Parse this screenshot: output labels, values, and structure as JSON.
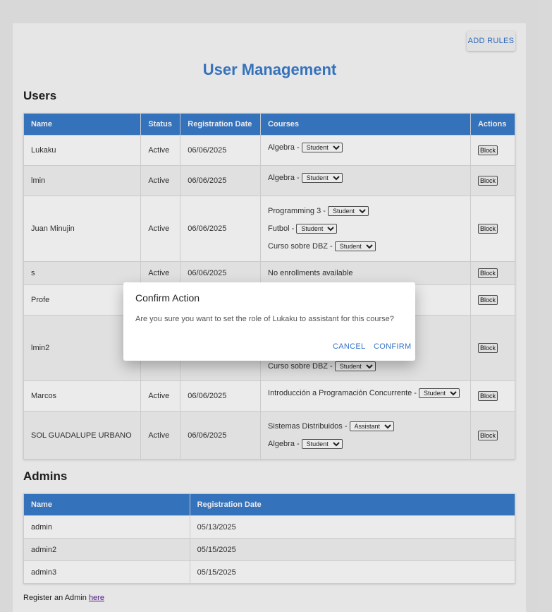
{
  "toolbar": {
    "add_rules": "ADD RULES"
  },
  "page_title": "User Management",
  "users": {
    "title": "Users",
    "headers": [
      "Name",
      "Status",
      "Registration Date",
      "Courses",
      "Actions"
    ],
    "block_label": "Block",
    "rows": [
      {
        "name": "Lukaku",
        "status": "Active",
        "date": "06/06/2025",
        "courses": [
          {
            "name": "Algebra -",
            "role": "Student"
          }
        ]
      },
      {
        "name": "lmin",
        "status": "Active",
        "date": "06/06/2025",
        "courses": [
          {
            "name": "Algebra -",
            "role": "Student"
          }
        ]
      },
      {
        "name": "Juan Minujin",
        "status": "Active",
        "date": "06/06/2025",
        "courses": [
          {
            "name": "Programming 3 -",
            "role": "Student"
          },
          {
            "name": "Futbol -",
            "role": "Student"
          },
          {
            "name": "Curso sobre DBZ -",
            "role": "Student"
          }
        ]
      },
      {
        "name": "s",
        "status": "Active",
        "date": "06/06/2025",
        "courses_text": "No enrollments available"
      },
      {
        "name": "Profe",
        "status": "",
        "date": "",
        "courses": []
      },
      {
        "name": "lmin2",
        "status": "",
        "date": "",
        "courses": [
          {
            "name": "Curso sobre DBZ -",
            "role": "Student"
          }
        ]
      },
      {
        "name": "Marcos",
        "status": "Active",
        "date": "06/06/2025",
        "courses": [
          {
            "name": "Introducción a Programación Concurrente -",
            "role": "Student"
          }
        ]
      },
      {
        "name": "SOL GUADALUPE URBANO",
        "status": "Active",
        "date": "06/06/2025",
        "courses": [
          {
            "name": "Sistemas Distribuidos -",
            "role": "Assistant"
          },
          {
            "name": "Algebra -",
            "role": "Student"
          }
        ]
      }
    ]
  },
  "admins": {
    "title": "Admins",
    "headers": [
      "Name",
      "Registration Date"
    ],
    "rows": [
      {
        "name": "admin",
        "date": "05/13/2025"
      },
      {
        "name": "admin2",
        "date": "05/15/2025"
      },
      {
        "name": "admin3",
        "date": "05/15/2025"
      }
    ]
  },
  "register": {
    "text": "Register an Admin ",
    "link": "here"
  },
  "dialog": {
    "title": "Confirm Action",
    "message": "Are you sure you want to set the role of Lukaku to assistant for this course?",
    "cancel": "CANCEL",
    "confirm": "CONFIRM"
  },
  "colors": {
    "accent": "#3a7ccc",
    "button_text": "#3273c8"
  }
}
